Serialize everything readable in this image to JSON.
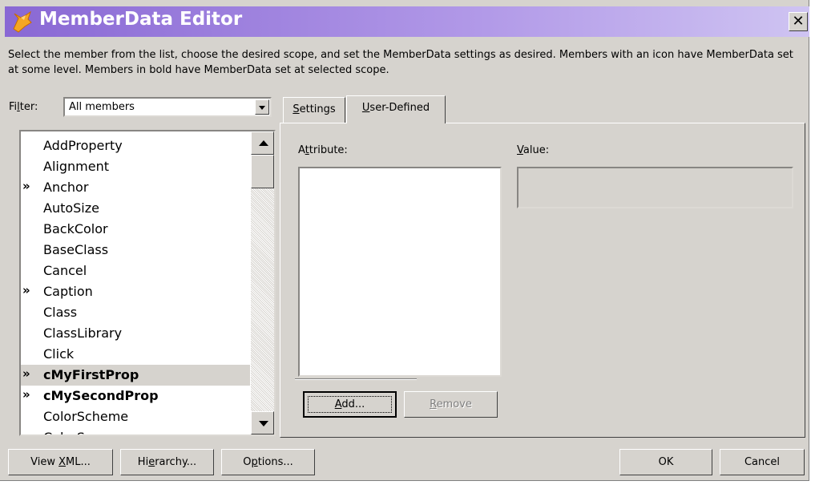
{
  "title": "MemberData Editor",
  "description": "Select the member from the list, choose the desired scope, and set the MemberData settings as desired. Members with an icon have MemberData set at some level. Members in bold have MemberData set at selected scope.",
  "filter": {
    "label_before": "Fi",
    "label_accel": "l",
    "label_after": "ter:",
    "value": "All members"
  },
  "members": [
    {
      "label": "AddProperty",
      "marker": "",
      "bold": false,
      "selected": false
    },
    {
      "label": "Alignment",
      "marker": "",
      "bold": false,
      "selected": false
    },
    {
      "label": "Anchor",
      "marker": "»",
      "bold": false,
      "selected": false
    },
    {
      "label": "AutoSize",
      "marker": "",
      "bold": false,
      "selected": false
    },
    {
      "label": "BackColor",
      "marker": "",
      "bold": false,
      "selected": false
    },
    {
      "label": "BaseClass",
      "marker": "",
      "bold": false,
      "selected": false
    },
    {
      "label": "Cancel",
      "marker": "",
      "bold": false,
      "selected": false
    },
    {
      "label": "Caption",
      "marker": "»",
      "bold": false,
      "selected": false
    },
    {
      "label": "Class",
      "marker": "",
      "bold": false,
      "selected": false
    },
    {
      "label": "ClassLibrary",
      "marker": "",
      "bold": false,
      "selected": false
    },
    {
      "label": "Click",
      "marker": "",
      "bold": false,
      "selected": false
    },
    {
      "label": "cMyFirstProp",
      "marker": "»",
      "bold": true,
      "selected": true
    },
    {
      "label": "cMySecondProp",
      "marker": "»",
      "bold": true,
      "selected": false
    },
    {
      "label": "ColorScheme",
      "marker": "",
      "bold": false,
      "selected": false
    },
    {
      "label": "ColorSource",
      "marker": "",
      "bold": false,
      "selected": false
    }
  ],
  "tabs": {
    "settings": {
      "accel": "S",
      "rest": "ettings"
    },
    "user_defined": {
      "accel": "U",
      "rest": "ser-Defined"
    },
    "active": "user_defined"
  },
  "panel": {
    "attribute": {
      "before": "A",
      "accel": "t",
      "after": "tribute:"
    },
    "value": {
      "accel": "V",
      "rest": "alue:"
    },
    "value_text": ""
  },
  "buttons": {
    "add": {
      "accel": "A",
      "rest": "dd..."
    },
    "remove": {
      "accel": "R",
      "rest": "emove"
    },
    "view_xml": {
      "before": "View ",
      "accel": "X",
      "after": "ML..."
    },
    "hierarchy": {
      "before": "Hi",
      "accel": "e",
      "after": "rarchy..."
    },
    "options": {
      "before": "O",
      "accel": "p",
      "after": "tions..."
    },
    "ok": "OK",
    "cancel": "Cancel"
  },
  "colors": {
    "face": "#d6d3ce",
    "title_start": "#8968d4",
    "title_end": "#cfc4f2",
    "selection": "#d6d3ce"
  },
  "icons": [
    "app-fox-icon",
    "close-icon",
    "dropdown-arrow-icon",
    "scroll-up-arrow-icon",
    "scroll-down-arrow-icon",
    "memberdata-marker-icon"
  ]
}
